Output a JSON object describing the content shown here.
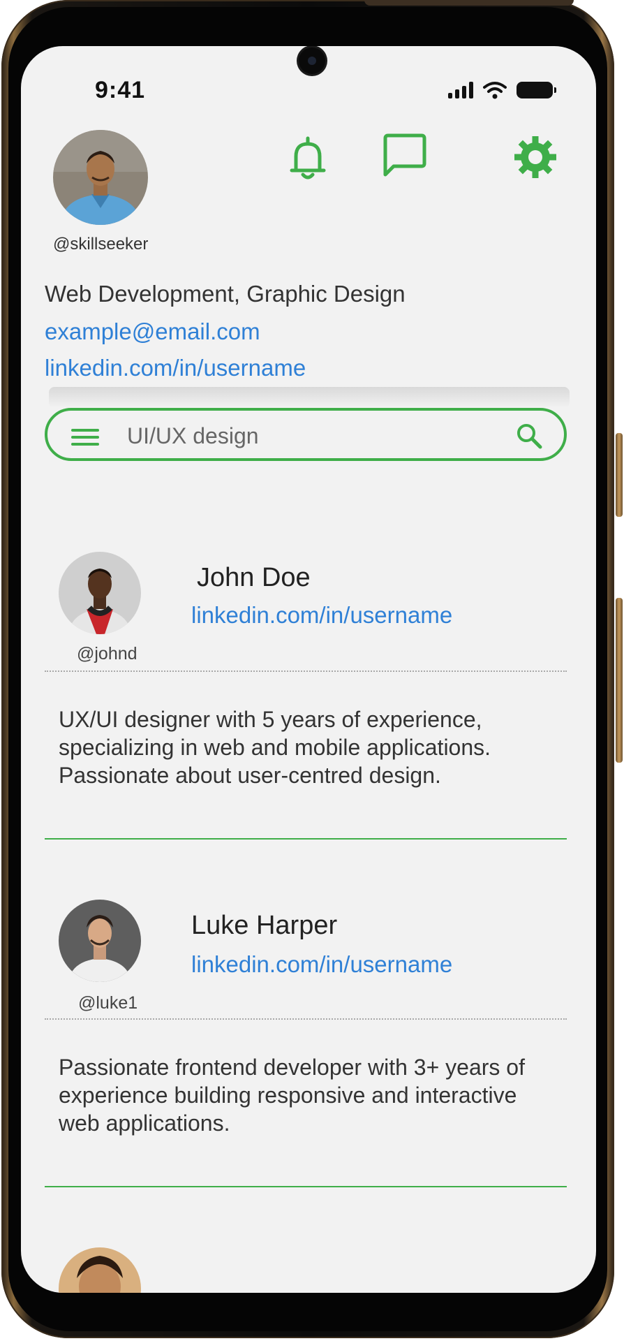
{
  "status_bar": {
    "time": "9:41"
  },
  "me": {
    "handle": "@skillseeker",
    "skills": "Web Development, Graphic Design",
    "email": "example@email.com",
    "linkedin": "linkedin.com/in/username"
  },
  "header_icons": [
    "bell-icon",
    "chat-icon",
    "gear-icon"
  ],
  "search": {
    "value": "UI/UX design"
  },
  "profiles": [
    {
      "handle": "@johnd",
      "name": "John Doe",
      "linkedin": "linkedin.com/in/username",
      "bio": "UX/UI designer with 5 years of experience, specializing in web and mobile applications. Passionate about user-centred design."
    },
    {
      "handle": "@luke1",
      "name": "Luke Harper",
      "linkedin": "linkedin.com/in/username",
      "bio": "Passionate frontend developer with 3+ years of experience building responsive and interactive web applications."
    }
  ],
  "colors": {
    "accent": "#3fae49",
    "link": "#2f80d6",
    "background": "#f2f2f2"
  }
}
